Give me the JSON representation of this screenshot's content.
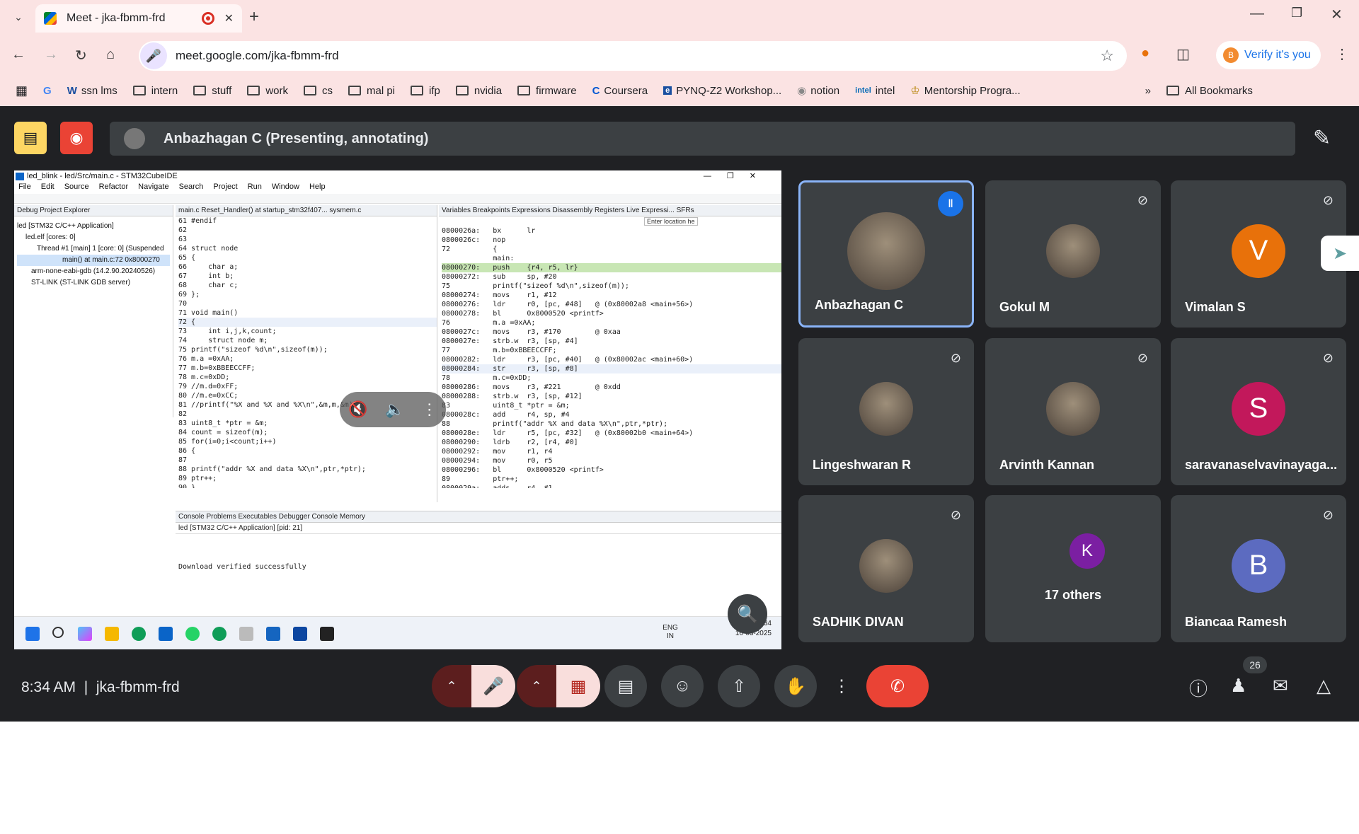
{
  "browser": {
    "tab_title": "Meet - jka-fbmm-frd",
    "url": "meet.google.com/jka-fbmm-frd",
    "verify_label": "Verify it's you",
    "bookmarks": [
      "ssn lms",
      "intern",
      "stuff",
      "work",
      "cs",
      "mal pi",
      "ifp",
      "nvidia",
      "firmware",
      "Coursera",
      "PYNQ-Z2 Workshop...",
      "notion",
      "intel",
      "Mentorship Progra..."
    ],
    "all_bookmarks": "All Bookmarks"
  },
  "meet": {
    "presenter_bar": "Anbazhagan C (Presenting, annotating)",
    "time": "8:34 AM",
    "meeting_code": "jka-fbmm-frd",
    "people_count": "26",
    "participants": [
      {
        "name": "Anbazhagan C",
        "type": "photo",
        "active": true
      },
      {
        "name": "Gokul M",
        "type": "photo"
      },
      {
        "name": "Vimalan S",
        "initial": "V",
        "color": "#e8710a"
      },
      {
        "name": "Lingeshwaran R",
        "type": "photo"
      },
      {
        "name": "Arvinth Kannan",
        "type": "photo"
      },
      {
        "name": "saravanaselvavinayaga...",
        "initial": "S",
        "color": "#c2185b"
      },
      {
        "name": "SADHIK DIVAN",
        "type": "photo"
      },
      {
        "name": "17 others",
        "initial": "K",
        "color": "#7b1fa2"
      },
      {
        "name": "Biancaa Ramesh",
        "initial": "B",
        "color": "#5c6bc0"
      }
    ],
    "colors": {
      "hangup": "#ea4335",
      "muted": "#f9dedc",
      "background": "#202124"
    }
  },
  "ide": {
    "window_title": "led_blink - led/Src/main.c - STM32CubeIDE",
    "menu": [
      "File",
      "Edit",
      "Source",
      "Refactor",
      "Navigate",
      "Search",
      "Project",
      "Run",
      "Window",
      "Help"
    ],
    "left_tabs": "Debug  Project Explorer",
    "tree": [
      "led [STM32 C/C++ Application]",
      "led.elf [cores: 0]",
      "Thread #1 [main] 1 [core: 0] (Suspended",
      "main() at main.c:72 0x8000270",
      "arm-none-eabi-gdb (14.2.90.20240526)",
      "ST-LINK (ST-LINK GDB server)"
    ],
    "editor_tabs": "main.c   Reset_Handler() at startup_stm32f407...   sysmem.c",
    "right_tabs": "Variables  Breakpoints  Expressions  Disassembly  Registers  Live Expressi...  SFRs",
    "location_placeholder": "Enter location he",
    "code_lines": [
      "61 #endif",
      "62",
      "63",
      "64 struct node",
      "65 {",
      "66     char a;",
      "67     int b;",
      "68     char c;",
      "69 };",
      "70",
      "71 void main()",
      "72 {",
      "73     int i,j,k,count;",
      "74     struct node m;",
      "75 printf(\"sizeof %d\\n\",sizeof(m));",
      "76 m.a =0xAA;",
      "77 m.b=0xBBEECCFF;",
      "78 m.c=0xDD;",
      "79 //m.d=0xFF;",
      "80 //m.e=0xCC;",
      "81 //printf(\"%X and %X and %X\\n\",&m,m,&m);",
      "82",
      "83 uint8_t *ptr = &m;",
      "84 count = sizeof(m);",
      "85 for(i=0;i<count;i++)",
      "86 {",
      "87",
      "88 printf(\"addr %X and data %X\\n\",ptr,*ptr);",
      "89 ptr++;",
      "90 }"
    ],
    "asm_lines": [
      "0800026a:   bx      lr",
      "0800026c:   nop",
      "72          {",
      "            main:",
      "08000270:   push    {r4, r5, lr}",
      "08000272:   sub     sp, #20",
      "75          printf(\"sizeof %d\\n\",sizeof(m));",
      "08000274:   movs    r1, #12",
      "08000276:   ldr     r0, [pc, #48]   @ (0x80002a8 <main+56>)",
      "08000278:   bl      0x8000520 <printf>",
      "76          m.a =0xAA;",
      "0800027c:   movs    r3, #170        @ 0xaa",
      "0800027e:   strb.w  r3, [sp, #4]",
      "77          m.b=0xBBEECCFF;",
      "08000282:   ldr     r3, [pc, #40]   @ (0x80002ac <main+60>)",
      "08000284:   str     r3, [sp, #8]",
      "78          m.c=0xDD;",
      "08000286:   movs    r3, #221        @ 0xdd",
      "08000288:   strb.w  r3, [sp, #12]",
      "83          uint8_t *ptr = &m;",
      "0800028c:   add     r4, sp, #4",
      "88          printf(\"addr %X and data %X\\n\",ptr,*ptr);",
      "0800028e:   ldr     r5, [pc, #32]   @ (0x80002b0 <main+64>)",
      "08000290:   ldrb    r2, [r4, #0]",
      "08000292:   mov     r1, r4",
      "08000294:   mov     r0, r5",
      "08000296:   bl      0x8000520 <printf>",
      "89          ptr++;",
      "0800029a:   adds    r4, #1"
    ],
    "console_tabs": "Console  Problems  Executables  Debugger Console  Memory",
    "console_header": "led [STM32 C/C++ Application]  [pid: 21]",
    "console_output": "Download verified successfully",
    "taskbar_lang": "ENG IN",
    "taskbar_time": "08:34",
    "taskbar_date": "16-03-2025"
  }
}
